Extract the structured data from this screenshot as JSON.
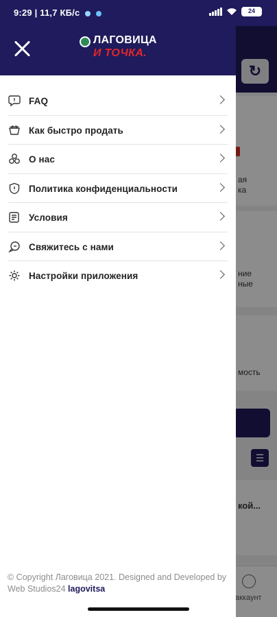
{
  "status_bar": {
    "time": "9:29 | 11,7 КБ/с",
    "battery": "24"
  },
  "drawer": {
    "logo": {
      "line1": "ЛАГОВИЦА",
      "line2": "И ТОЧКА."
    },
    "menu": [
      {
        "label": "FAQ",
        "icon": "faq-icon"
      },
      {
        "label": "Как быстро продать",
        "icon": "sell-icon"
      },
      {
        "label": "О нас",
        "icon": "about-icon"
      },
      {
        "label": "Политика конфиденциальности",
        "icon": "privacy-shield-icon"
      },
      {
        "label": "Условия",
        "icon": "terms-icon"
      },
      {
        "label": "Свяжитесь с нами",
        "icon": "contact-icon"
      },
      {
        "label": "Настройки приложения",
        "icon": "settings-gear-icon"
      }
    ],
    "footer": {
      "text": "© Copyright Лаговица 2021. Designed and Developed by Web Studios24",
      "brand": "lagovitsa"
    }
  },
  "background": {
    "fragment_1": "ая\nка",
    "fragment_2": "ние\nные",
    "fragment_3": "мость",
    "fragment_4": "кой...",
    "nav_account": "аккаунт"
  },
  "colors": {
    "primary": "#1f1b5c",
    "accent_red": "#e0262b",
    "drawer_bg": "#ffffff"
  }
}
